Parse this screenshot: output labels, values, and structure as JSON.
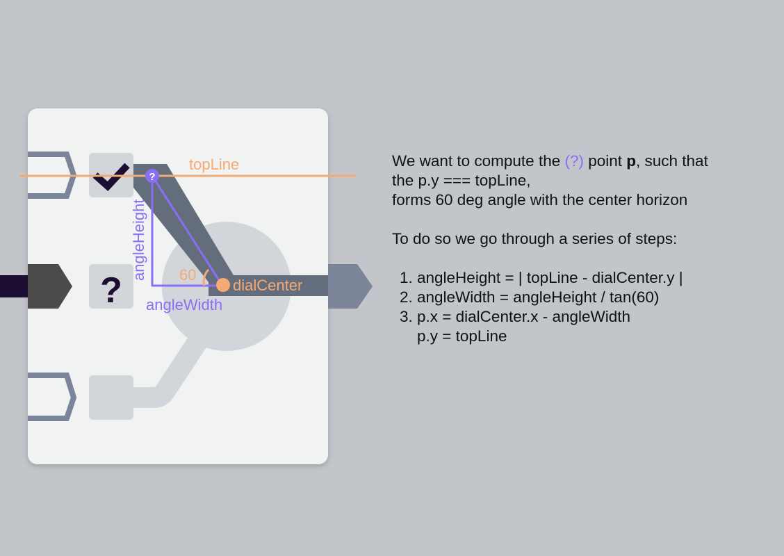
{
  "diagram": {
    "labels": {
      "top_line": "topLine",
      "angle_height": "angleHeight",
      "angle_width": "angleWidth",
      "dial_center": "dialCenter",
      "angle_value": "60",
      "point_marker": "?",
      "question_block": "?"
    },
    "colors": {
      "background": "#c2c6ca",
      "card": "#f1f2f2",
      "orange": "#f4aa72",
      "purple": "#8a6ef4",
      "track": "#646d7c",
      "dark": "#1c0d33",
      "arrow_gray": "#7b8498",
      "block": "#d2d6da",
      "input_dark": "#4d4a4a"
    },
    "icons": [
      "check-icon",
      "question-icon"
    ]
  },
  "explanation": {
    "line1_before": "We want to compute the ",
    "line1_marker": "(?)",
    "line1_middle": " point ",
    "line1_bold": "p",
    "line1_after": ", such that",
    "line2": "the p.y === topLine,",
    "line3": "forms 60 deg angle with the center horizon",
    "intro": "To do so we go through a series of steps:",
    "steps": [
      "angleHeight = | topLine - dialCenter.y |",
      "angleWidth = angleHeight / tan(60)",
      "p.x = dialCenter.x - angleWidth"
    ],
    "step3_cont": "p.y = topLine"
  }
}
